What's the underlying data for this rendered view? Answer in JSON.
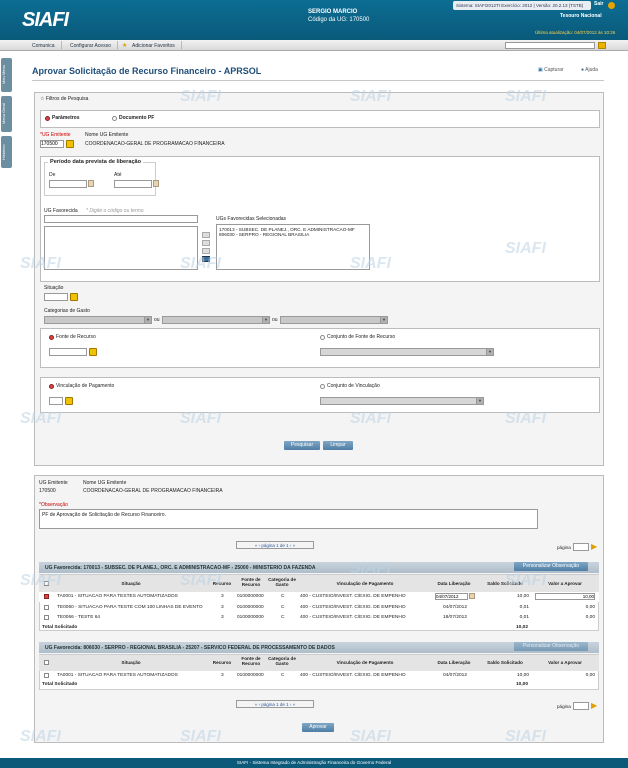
{
  "header": {
    "logo": "SIAFI",
    "user_name": "SERGIO MARCIO",
    "ug_code": "Código da UG: 170500",
    "topbar": "Sistema: SIAFI2012TI  Exercício: 2012 | Versão: 20.2.13 (TSTB)",
    "sair": "Sair",
    "tesouro": "Tesouro Nacional",
    "updated": "Última atualização: 04/07/2012 às 10:26"
  },
  "menu": {
    "tabs": [
      "Comunica",
      "Configurar Acesso",
      "Adicionar Favoritos"
    ]
  },
  "side": {
    "tabs": [
      "Meu Menu",
      "Menu Geral",
      "Histórico"
    ]
  },
  "page": {
    "title": "Aprovar Solicitação de Recurso Financeiro - APRSOL",
    "capturar": "Capturar",
    "ajuda": "Ajuda"
  },
  "filters": {
    "legend": "Filtros de Pesquisa",
    "opt_parametros": "Parâmetros",
    "opt_documento": "Documento PF",
    "ug_emitente_label": "*UG Emitente",
    "ug_emitente_value": "170500",
    "nome_ug_label": "Nome UG Emitente",
    "nome_ug_value": "COORDENACAO-GERAL DE PROGRAMACAO FINANCEIRA",
    "periodo_legend": "Período data prevista de liberação",
    "de": "De",
    "ate": "Até",
    "ug_favorecida_label": "UG Favorecida",
    "ug_favorecida_hint": "* Digite o código ou termo",
    "ugs_selecionadas_label": "UGs Favorecidas Selecionadas",
    "ugs_selecionadas": [
      "170013 - SUBSEC. DE PLANEJ., ORC. E ADMINISTRACAO-MF",
      "806030 - SERPRO - REGIONAL BRASILIA"
    ],
    "situacao": "Situação",
    "categorias": "Categorias de Gasto",
    "ou1": "ou",
    "ou2": "ou",
    "fonte_recurso": "Fonte de Recurso",
    "conjunto_fonte": "Conjunto de Fonte de Recurso",
    "vinculacao": "Vinculação de Pagamento",
    "conjunto_vinculacao": "Conjunto de Vinculação",
    "btn_pesquisar": "Pesquisar",
    "btn_limpar": "Limpar"
  },
  "result": {
    "ug_emitente_label": "UG Emitente",
    "ug_emitente_value": "170500",
    "nome_ug_label": "Nome UG Emitente",
    "nome_ug_value": "COORDENACAO-GERAL DE PROGRAMACAO FINANCEIRA",
    "obs_label": "*Observação",
    "obs_value": "PF de Aprovação de Solicitação de Recurso Financeiro.",
    "pager": "página 1 de 1",
    "pagina": "página",
    "columns": [
      "Situação",
      "Recurso",
      "Fonte de Recurso",
      "Categoria de Gasto",
      "Vinculação de Pagamento",
      "Data Liberação",
      "Saldo Solicitado",
      "Valor a Aprovar"
    ],
    "personalizar": "Personalizar Observação",
    "groups": [
      {
        "title": "UG Favorecida: 170013 - SUBSEC. DE PLANEJ., ORC. E ADMINISTRACAO-MF - 25000 - MINISTERIO DA FAZENDA",
        "rows": [
          {
            "situacao": "TA0001 - SITUACAO PARA TESTES AUTOMATIZADOS",
            "recurso": "3",
            "fonte": "0100000000",
            "cat": "C",
            "vinc": "400 - CUSTEIO/INVEST. C/EXIG. DE EMPENHO",
            "data": "04/07/2012",
            "saldo": "10,00",
            "valor": "10,00",
            "checked": true
          },
          {
            "situacao": "TE0060 - SITUACAO PARA TESTE COM 100 LINHAS DE EVENTO",
            "recurso": "3",
            "fonte": "0100000000",
            "cat": "C",
            "vinc": "400 - CUSTEIO/INVEST. C/EXIG. DE EMPENHO",
            "data": "04/07/2012",
            "saldo": "0,01",
            "valor": "0,00",
            "checked": false
          },
          {
            "situacao": "TE0066 - TESTE 64",
            "recurso": "3",
            "fonte": "0100000000",
            "cat": "C",
            "vinc": "400 - CUSTEIO/INVEST. C/EXIG. DE EMPENHO",
            "data": "18/07/2012",
            "saldo": "0,01",
            "valor": "0,00",
            "checked": false
          }
        ],
        "total_label": "Total Solicitado",
        "total": "10,02"
      },
      {
        "title": "UG Favorecida: 806030 - SERPRO - REGIONAL BRASILIA - 25207 - SERVICO FEDERAL DE PROCESSAMENTO DE DADOS",
        "rows": [
          {
            "situacao": "TA0001 - SITUACAO PARA TESTES AUTOMATIZADOS",
            "recurso": "3",
            "fonte": "0100000000",
            "cat": "C",
            "vinc": "400 - CUSTEIO/INVEST. C/EXIG. DE EMPENHO",
            "data": "04/07/2012",
            "saldo": "10,00",
            "valor": "0,00",
            "checked": false
          }
        ],
        "total_label": "Total Solicitado",
        "total": "10,00"
      }
    ],
    "btn_aprovar": "Aprovar"
  },
  "footer": "SIAFI - Sistema Integrado de Administração Financeira do Governo Federal",
  "watermark": "SIAFI"
}
